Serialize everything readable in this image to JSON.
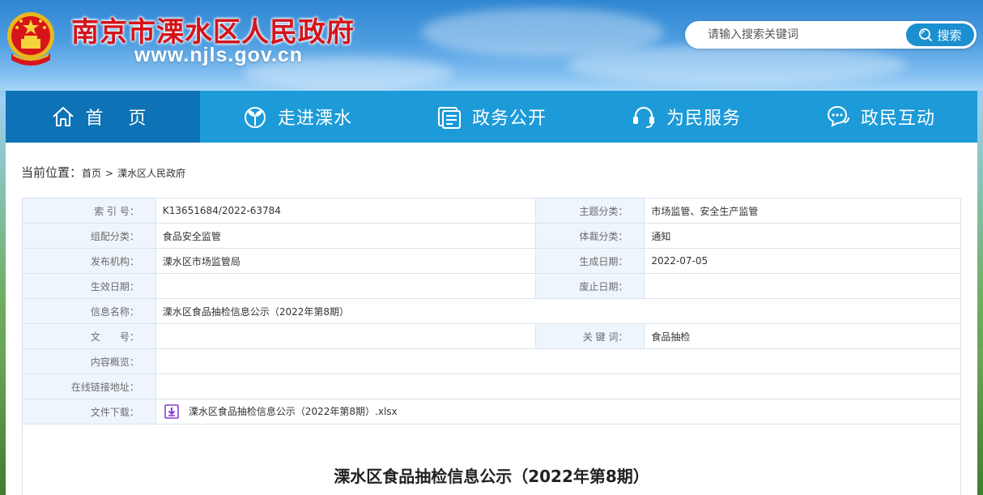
{
  "header": {
    "site_title": "南京市溧水区人民政府",
    "site_url": "www.njls.gov.cn",
    "emblem_icon": "national-emblem-icon"
  },
  "search": {
    "placeholder": "请输入搜索关键词",
    "button_label": "搜索",
    "button_icon": "search-icon"
  },
  "nav": {
    "items": [
      {
        "label": "首 页",
        "icon": "home-icon",
        "active": true
      },
      {
        "label": "走进溧水",
        "icon": "sprout-icon",
        "active": false
      },
      {
        "label": "政务公开",
        "icon": "document-icon",
        "active": false
      },
      {
        "label": "为民服务",
        "icon": "headset-icon",
        "active": false
      },
      {
        "label": "政民互动",
        "icon": "chat-icon",
        "active": false
      }
    ]
  },
  "breadcrumb": {
    "prefix": "当前位置：",
    "items": [
      "首页",
      "溧水区人民政府"
    ],
    "separator": ">"
  },
  "meta": {
    "index_no_label": "索 引 号：",
    "index_no": "K13651684/2022-63784",
    "topic_label": "主题分类：",
    "topic": "市场监管、安全生产监管",
    "category_label": "组配分类：",
    "category": "食品安全监管",
    "genre_label": "体裁分类：",
    "genre": "通知",
    "publisher_label": "发布机构：",
    "publisher": "溧水区市场监管局",
    "date_label": "生成日期：",
    "date": "2022-07-05",
    "effective_label": "生效日期：",
    "effective": "",
    "repeal_label": "废止日期：",
    "repeal": "",
    "name_label": "信息名称：",
    "name": "溧水区食品抽检信息公示（2022年第8期）",
    "doc_no_label": "文　　号：",
    "doc_no": "",
    "keywords_label": "关 键 词：",
    "keywords": "食品抽检",
    "summary_label": "内容概览：",
    "summary": "",
    "link_label": "在线链接地址：",
    "link": "",
    "download_label": "文件下载：",
    "download_file": "溧水区食品抽检信息公示（2022年第8期）.xlsx"
  },
  "article": {
    "title": "溧水区食品抽检信息公示（2022年第8期）"
  },
  "colors": {
    "nav_bg": "#1d9bd8",
    "nav_active": "#0e72b6",
    "title_red": "#d4141b",
    "search_btn": "#1c8fd0",
    "label_bg": "#eef5fd"
  }
}
